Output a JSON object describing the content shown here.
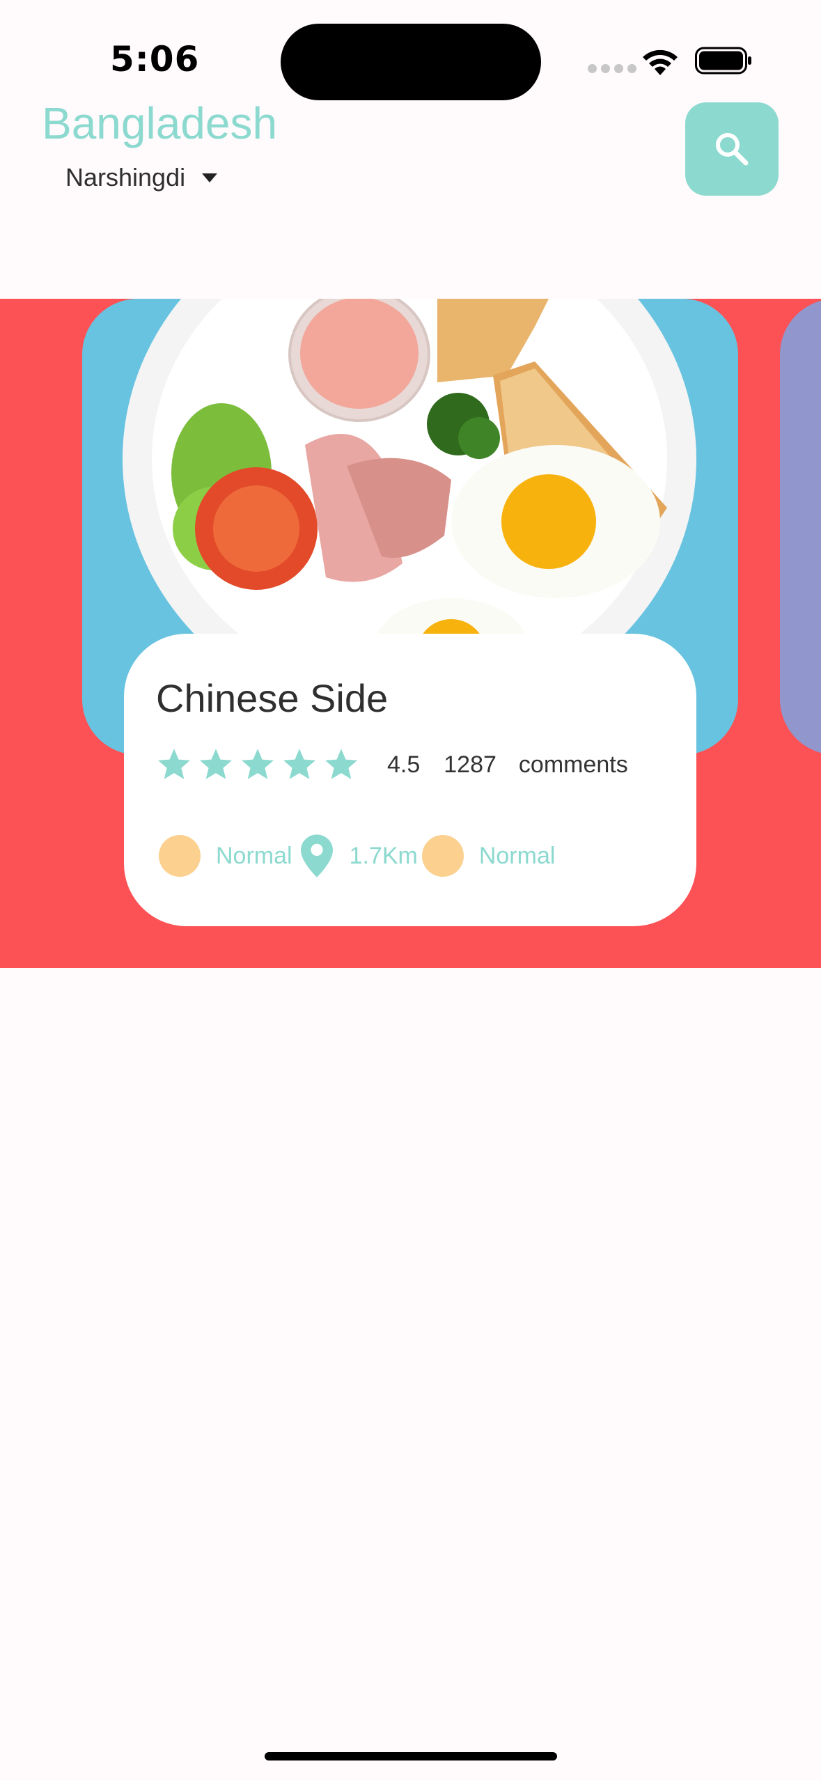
{
  "status_bar": {
    "time": "5:06"
  },
  "header": {
    "country": "Bangladesh",
    "city": "Narshingdi"
  },
  "food_card": {
    "title": "Chinese Side",
    "stars_filled": 5,
    "rating": "4.5",
    "comment_count": "1287",
    "comments_label": "comments",
    "meta": [
      {
        "label": "Normal"
      },
      {
        "label": "1.7Km"
      },
      {
        "label": "Normal"
      }
    ]
  },
  "colors": {
    "accent": "#8bd9cf",
    "band": "#fd5255",
    "card_blue": "#68c3e0",
    "next_card": "#9196cc",
    "dot": "#fcd08e"
  },
  "icons": {
    "search": "search-icon",
    "location": "location-pin-icon",
    "dropdown": "caret-down-icon"
  }
}
